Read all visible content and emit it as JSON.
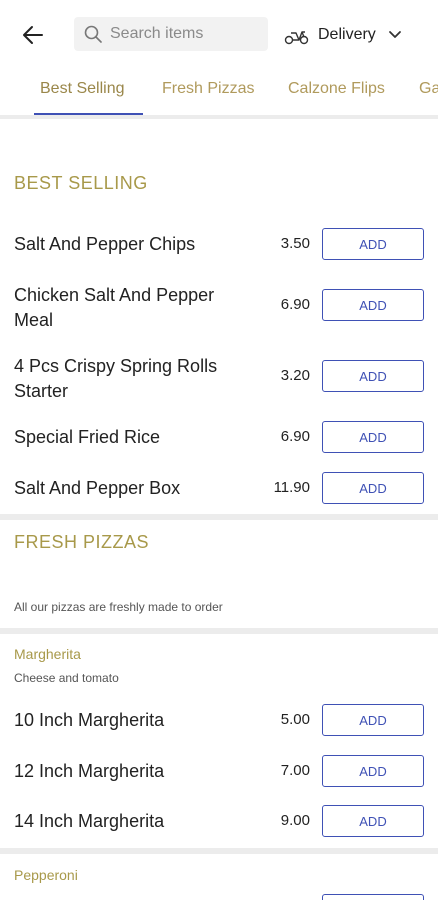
{
  "header": {
    "search_placeholder": "Search items",
    "delivery_label": "Delivery"
  },
  "tabs": [
    "Best Selling",
    "Fresh Pizzas",
    "Calzone Flips",
    "Ga"
  ],
  "colors": {
    "accent": "#3f51b5",
    "section_title": "#a8994a"
  },
  "best_selling": {
    "title": "BEST SELLING",
    "items": [
      {
        "name": "Salt And Pepper Chips",
        "price": "3.50",
        "add": "ADD"
      },
      {
        "name": "Chicken Salt And Pepper Meal",
        "price": "6.90",
        "add": "ADD"
      },
      {
        "name": "4 Pcs Crispy Spring Rolls Starter",
        "price": "3.20",
        "add": "ADD"
      },
      {
        "name": "Special Fried Rice",
        "price": "6.90",
        "add": "ADD"
      },
      {
        "name": "Salt And Pepper Box",
        "price": "11.90",
        "add": "ADD"
      }
    ]
  },
  "fresh_pizzas": {
    "title": "FRESH PIZZAS",
    "note": "All our pizzas are freshly made to order",
    "margherita": {
      "title": "Margherita",
      "description": "Cheese and tomato",
      "items": [
        {
          "name": "10 Inch Margherita",
          "price": "5.00",
          "add": "ADD"
        },
        {
          "name": "12 Inch Margherita",
          "price": "7.00",
          "add": "ADD"
        },
        {
          "name": "14 Inch Margherita",
          "price": "9.00",
          "add": "ADD"
        }
      ]
    },
    "pepperoni": {
      "title": "Pepperoni"
    }
  }
}
